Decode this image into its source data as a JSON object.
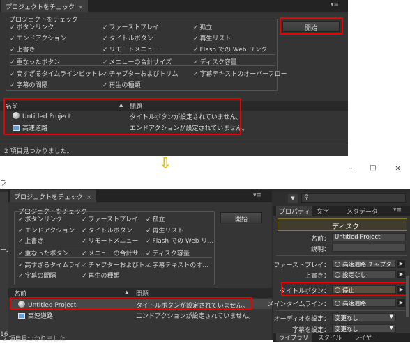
{
  "top": {
    "tab_label": "プロジェクトをチェック",
    "close_glyph": "×",
    "menu_glyph": "▾≡",
    "group_label": "プロジェクトをチェック",
    "checks": [
      "ボタンリンク",
      "ファーストプレイ",
      "孤立",
      "エンドアクション",
      "タイトルボタン",
      "再生リスト",
      "上書き",
      "リモートメニュー",
      "Flash での Web リンク",
      "重なったボタン",
      "メニューの合計サイズ",
      "ディスク容量",
      "高すぎるタイムラインビットレ…",
      "チャプターおよびトリム",
      "字幕テキストのオーバーフロー",
      "字幕の間隔",
      "再生の種類"
    ],
    "start_button": "開始",
    "col_name": "名前",
    "col_issue": "問題",
    "sort_glyph": "▲",
    "rows": [
      {
        "name": "Untitled Project",
        "issue": "タイトルボタンが設定されていません。"
      },
      {
        "name": "高速道路",
        "issue": "エンドアクションが設定されていません。"
      }
    ],
    "status": "2 項目見つかりました。"
  },
  "arrow": "⇩",
  "bottom": {
    "window_title_fragment": "ラ",
    "win_controls": [
      "_",
      "□",
      "×"
    ],
    "tab_label": "プロジェクトをチェック",
    "close_glyph": "×",
    "menu_glyph": "▾≡",
    "group_label": "プロジェクトをチェック",
    "checks": [
      "ボタンリンク",
      "ファーストプレイ",
      "孤立",
      "エンドアクション",
      "タイトルボタン",
      "再生リスト",
      "上書き",
      "リモートメニュー",
      "Flash での Web リ…",
      "重なったボタン",
      "メニューの合計サ…",
      "ディスク容量",
      "高すぎるタイムライ…",
      "チャプターおよびト…",
      "字幕テキストのオ…",
      "字幕の間隔",
      "再生の種類"
    ],
    "start_button": "開始",
    "col_name": "名前",
    "col_issue": "問題",
    "sort_glyph": "▲",
    "rows": [
      {
        "name": "Untitled Project",
        "issue": "タイトルボタンが設定されていません。"
      },
      {
        "name": "高速道路",
        "issue": "エンドアクションが設定されていません。"
      }
    ],
    "status": "2 項目見つかりました",
    "left_fragments": [
      "ーム",
      "16"
    ],
    "search_icon": "⚲",
    "props": {
      "tabs": [
        "プロパティ",
        "文字",
        "メタデータ"
      ],
      "heading": "ディスク",
      "name_label": "名前：",
      "name_value": "Untitled Project",
      "desc_label": "説明：",
      "first_play_label": "ファーストプレイ：",
      "first_play_value": "高速道路:チャプタ…",
      "overwrite_label": "上書き：",
      "overwrite_value": "設定なし",
      "title_button_label": "タイトルボタン：",
      "title_button_value": "停止",
      "main_timeline_label": "メインタイムライン：",
      "main_timeline_value": "高速道路",
      "audio_label": "オーディオを設定：",
      "audio_value": "変更なし",
      "subtitle_label": "字幕を設定：",
      "subtitle_value": "変更なし",
      "bottom_tabs": [
        "ライブラリ",
        "スタイル",
        "レイヤー"
      ]
    }
  }
}
